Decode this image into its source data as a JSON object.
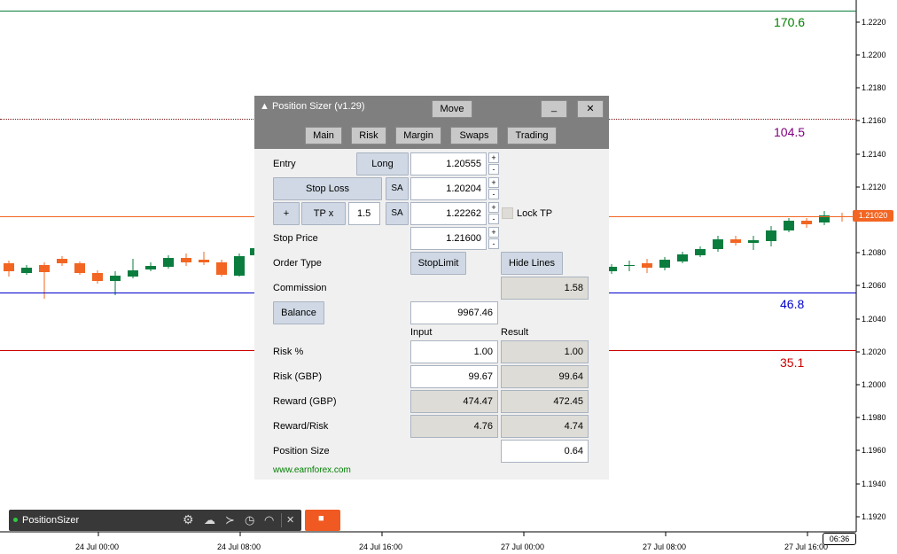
{
  "levels": {
    "tp_value": "170.6",
    "tp_color": "#008000",
    "entry_value": "104.5",
    "entry_color": "#800080",
    "stop_price_value": "46.8",
    "stop_price_color": "#0000cc",
    "sl_value": "35.1",
    "sl_color": "#cc0000"
  },
  "price_axis": [
    "1.2220",
    "1.2200",
    "1.2180",
    "1.2160",
    "1.2140",
    "1.2120",
    "1.2080",
    "1.2060",
    "1.2040",
    "1.2020",
    "1.2000",
    "1.1980",
    "1.1960",
    "1.1940",
    "1.1920"
  ],
  "current_price": "1.21020",
  "time_axis": [
    "24 Jul 00:00",
    "24 Jul 08:00",
    "24 Jul 16:00",
    "27 Jul 00:00",
    "27 Jul 08:00",
    "27 Jul 16:00"
  ],
  "current_time": "06:36",
  "colors": {
    "bull": "#0a7d3e",
    "bear": "#f26522"
  },
  "panel": {
    "title": "▲ Position Sizer (v1.29)",
    "move": "Move",
    "minimize": "_",
    "close": "✕",
    "tabs": [
      "Main",
      "Risk",
      "Margin",
      "Swaps",
      "Trading"
    ],
    "entry_label": "Entry",
    "direction": "Long",
    "entry": "1.20555",
    "stop_loss_button": "Stop Loss",
    "sa": "SA",
    "stop_loss": "1.20204",
    "plus": "+",
    "tp_x": "TP x",
    "tp_mult": "1.5",
    "take_profit": "1.22262",
    "lock_tp": "Lock TP",
    "stop_price_label": "Stop Price",
    "stop_price": "1.21600",
    "order_type_label": "Order Type",
    "order_type": "StopLimit",
    "hide_lines": "Hide Lines",
    "commission_label": "Commission",
    "commission": "1.58",
    "balance_button": "Balance",
    "balance": "9967.46",
    "input_header": "Input",
    "result_header": "Result",
    "risk_pct_label": "Risk %",
    "risk_pct_input": "1.00",
    "risk_pct_result": "1.00",
    "risk_money_label": "Risk (GBP)",
    "risk_money_input": "99.67",
    "risk_money_result": "99.64",
    "reward_money_label": "Reward (GBP)",
    "reward_money_input": "474.47",
    "reward_money_result": "472.45",
    "rr_label": "Reward/Risk",
    "rr_input": "4.76",
    "rr_result": "4.74",
    "position_size_label": "Position Size",
    "position_size": "0.64",
    "website": "www.earnforex.com",
    "spin_up": "+",
    "spin_down": "-"
  },
  "toolbar": {
    "name": "PositionSizer",
    "close": "✕",
    "settings_icon": "⚙",
    "cloud_icon": "☁",
    "terminal_icon": "≻",
    "timer_icon": "◷",
    "gauge_icon": "◠",
    "stop_icon": "■"
  }
}
